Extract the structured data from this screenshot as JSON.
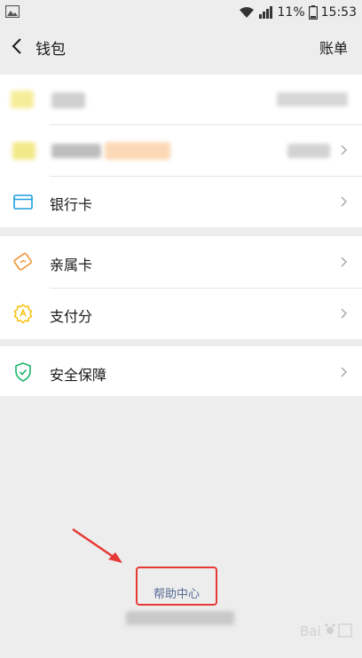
{
  "status_bar": {
    "battery": "11%",
    "time": "15:53"
  },
  "nav": {
    "title": "钱包",
    "right_action": "账单"
  },
  "groups": [
    {
      "items": [
        {
          "label": "银行卡",
          "icon": "bank-card-icon"
        }
      ]
    },
    {
      "items": [
        {
          "label": "亲属卡",
          "icon": "family-card-icon"
        },
        {
          "label": "支付分",
          "icon": "pay-score-icon"
        }
      ]
    },
    {
      "items": [
        {
          "label": "安全保障",
          "icon": "security-shield-icon"
        }
      ]
    }
  ],
  "footer": {
    "help_center": "帮助中心"
  },
  "colors": {
    "background": "#ededed",
    "link": "#576b95",
    "highlight_box": "#e53935",
    "bank_icon": "#1a9fe0",
    "family_icon": "#f0953a",
    "score_icon": "#f4c20d",
    "shield_icon": "#19b46a"
  }
}
